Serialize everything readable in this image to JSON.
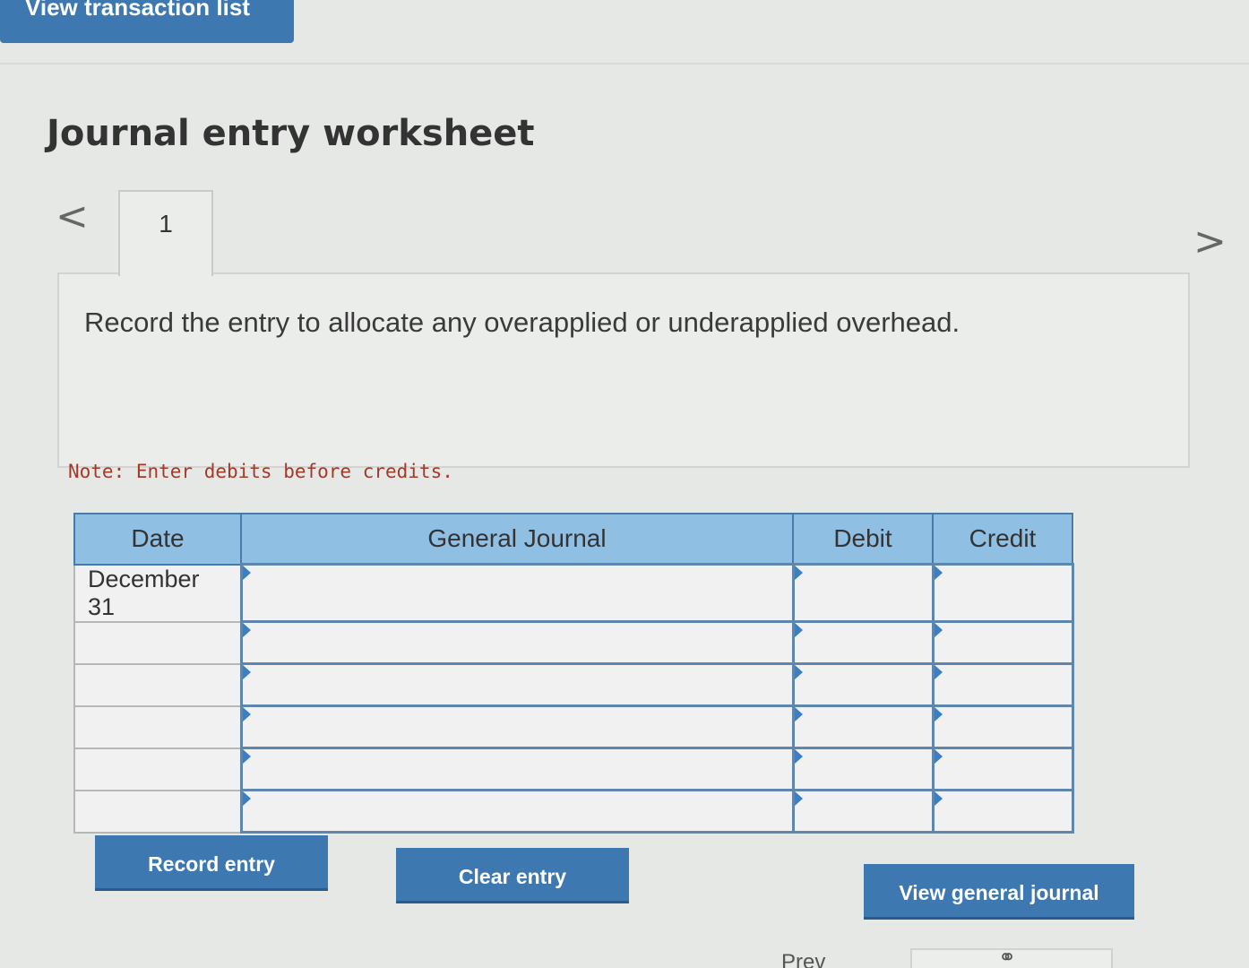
{
  "top_button": {
    "label": "View transaction list"
  },
  "title": "Journal entry worksheet",
  "navigation": {
    "prev_glyph": "<",
    "next_glyph": ">",
    "tabs": [
      {
        "label": "1"
      }
    ]
  },
  "prompt": "Record the entry to allocate any overapplied or underapplied overhead.",
  "note": "Note: Enter debits before credits.",
  "table": {
    "headers": {
      "date": "Date",
      "journal": "General Journal",
      "debit": "Debit",
      "credit": "Credit"
    },
    "rows": [
      {
        "date": "December 31",
        "journal": "",
        "debit": "",
        "credit": ""
      },
      {
        "date": "",
        "journal": "",
        "debit": "",
        "credit": ""
      },
      {
        "date": "",
        "journal": "",
        "debit": "",
        "credit": ""
      },
      {
        "date": "",
        "journal": "",
        "debit": "",
        "credit": ""
      },
      {
        "date": "",
        "journal": "",
        "debit": "",
        "credit": ""
      },
      {
        "date": "",
        "journal": "",
        "debit": "",
        "credit": ""
      }
    ]
  },
  "buttons": {
    "record": "Record entry",
    "clear": "Clear entry",
    "view_journal": "View general journal"
  },
  "bottom": {
    "partial_text": "Prev",
    "icon": "link-icon"
  },
  "colors": {
    "button_blue": "#3d78b0",
    "header_blue": "#8fbfe3",
    "note_red": "#a23a2a"
  }
}
